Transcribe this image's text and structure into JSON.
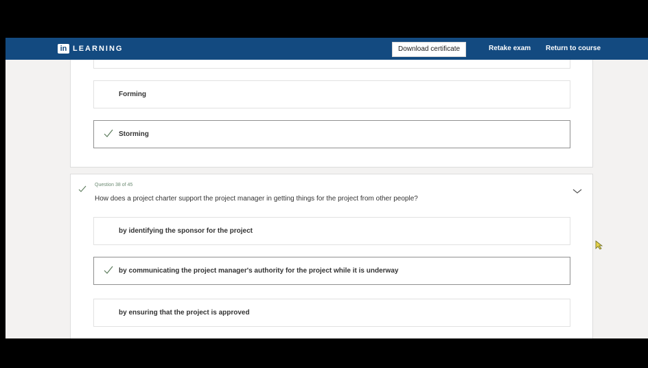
{
  "app": {
    "logo_mark": "in",
    "logo_text": "LEARNING"
  },
  "header": {
    "download_label": "Download certificate",
    "retake_label": "Retake exam",
    "return_label": "Return to course"
  },
  "previous_question": {
    "answers": [
      {
        "label": "Forming",
        "correct": false
      },
      {
        "label": "Storming",
        "correct": true
      }
    ]
  },
  "question": {
    "meta": "Question 38 of 45",
    "text": "How does a project charter support the project manager in getting things for the project from other people?",
    "answers": [
      {
        "label": "by identifying the sponsor for the project",
        "correct": false
      },
      {
        "label": "by communicating the project manager's authority for the project while it is underway",
        "correct": true
      },
      {
        "label": "by ensuring that the project is approved",
        "correct": false
      }
    ]
  },
  "colors": {
    "topbar": "#134a80",
    "check": "#5a7a5a"
  },
  "icons": [
    "linkedin-logo",
    "check-icon",
    "chevron-down-icon",
    "cursor-icon"
  ]
}
